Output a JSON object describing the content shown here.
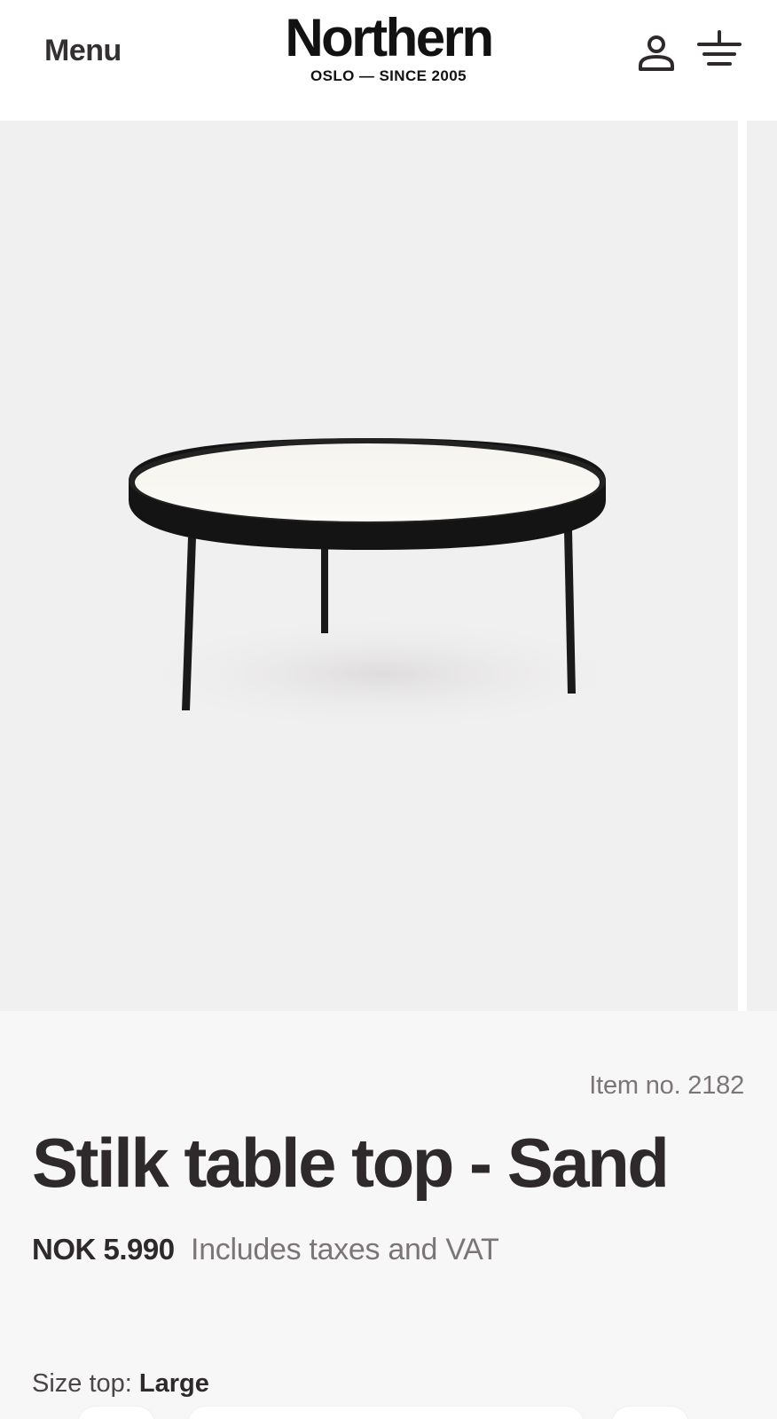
{
  "header": {
    "menu_label": "Menu",
    "brand_name": "Northern",
    "brand_tagline": "OSLO — SINCE 2005",
    "user_icon": "user-icon",
    "cart_icon": "cart-icon"
  },
  "gallery": {
    "slide_count_visible": 1,
    "background_color": "#f1f0f1"
  },
  "product": {
    "item_number": "Item no. 2182",
    "title": "Stilk table top - Sand",
    "price": "NOK 5.990",
    "tax_note": "Includes taxes and VAT",
    "size_label": "Size top: ",
    "size_value": "Large"
  },
  "colors": {
    "text_primary": "#2e2a2b",
    "text_muted": "#7c7577",
    "info_background": "#f8f7f7"
  }
}
